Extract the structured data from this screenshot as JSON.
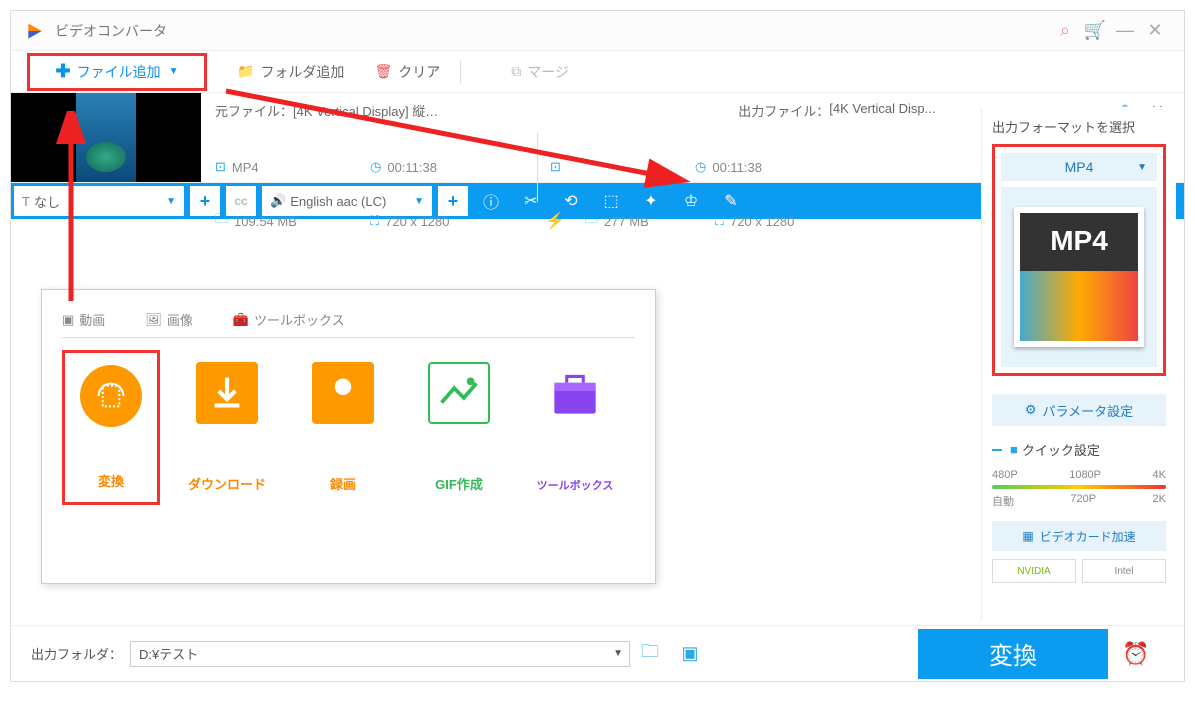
{
  "titlebar": {
    "title": "ビデオコンバータ"
  },
  "menubar": {
    "addfile": "ファイル追加",
    "addfolder": "フォルダ追加",
    "clear": "クリア",
    "merge": "マージ"
  },
  "file": {
    "src_label": "元ファイル：",
    "src_name": "[4K Vertical Display] 縦…",
    "out_label": "出力ファイル：",
    "out_name": "[4K Vertical Disp...",
    "src_format": "MP4",
    "src_duration": "00:11:38",
    "src_size": "109.54 MB",
    "src_res": "720 x 1280",
    "out_duration": "00:11:38",
    "out_size": "277 MB",
    "out_res": "720 x 1280"
  },
  "toolrow": {
    "subtitle": "なし",
    "audio": "English aac (LC)"
  },
  "panel": {
    "tab_video": "動画",
    "tab_image": "画像",
    "tab_tools": "ツールボックス",
    "tiles": {
      "convert": "変換",
      "download": "ダウンロード",
      "record": "録画",
      "gif": "GIF作成",
      "toolbox": "ツールボックス"
    }
  },
  "right": {
    "title": "出力フォーマットを選択",
    "format": "MP4",
    "param": "パラメータ設定",
    "quick": "クイック設定",
    "presets_top": [
      "480P",
      "1080P",
      "4K"
    ],
    "presets_bottom": [
      "自動",
      "720P",
      "2K"
    ],
    "gpu": "ビデオカード加速",
    "nvidia": "NVIDIA",
    "intel": "Intel"
  },
  "bottom": {
    "label": "出力フォルダ：",
    "path": "D:¥テスト",
    "convert": "変換"
  }
}
